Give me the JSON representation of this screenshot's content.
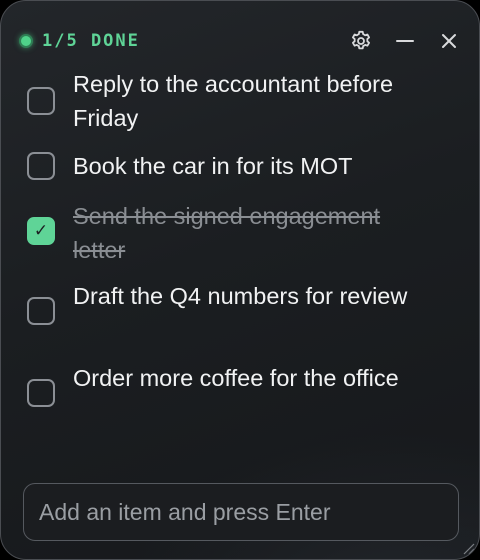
{
  "header": {
    "status_text": "1/5 DONE",
    "colors": {
      "accent": "#5fd497",
      "icon": "#d9dadc"
    },
    "icons": [
      "gear-icon",
      "minimize-icon",
      "close-icon"
    ]
  },
  "items": [
    {
      "text": "Reply to the accountant before Friday",
      "done": false
    },
    {
      "text": "Book the car in for its MOT",
      "done": false
    },
    {
      "text": "Send the signed engagement letter",
      "done": true,
      "check_glyph": "✓"
    },
    {
      "text": "Draft the Q4 numbers for review",
      "done": false
    },
    {
      "text": "Order more coffee for the office",
      "done": false
    }
  ],
  "add_item": {
    "placeholder": "Add an item and press Enter",
    "value": ""
  }
}
